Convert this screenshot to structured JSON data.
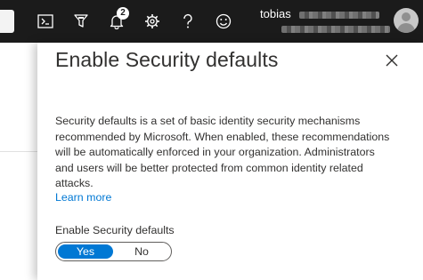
{
  "topbar": {
    "icons": [
      "cloud-shell-icon",
      "directory-filter-icon",
      "notifications-icon",
      "settings-icon",
      "help-icon",
      "feedback-icon"
    ],
    "notifications_count": "2",
    "account_name": "tobias"
  },
  "panel": {
    "title": "Enable Security defaults",
    "description": "Security defaults is a set of basic identity security mechanisms recommended by Microsoft. When enabled, these recommendations will be automatically enforced in your organization. Administrators and users will be better protected from common identity related attacks.",
    "learn_more": "Learn more",
    "toggle": {
      "label": "Enable Security defaults",
      "options": [
        "Yes",
        "No"
      ],
      "selected": "Yes"
    }
  },
  "colors": {
    "topbar_bg": "#1b1b1b",
    "accent": "#0078d4",
    "text": "#323130"
  }
}
